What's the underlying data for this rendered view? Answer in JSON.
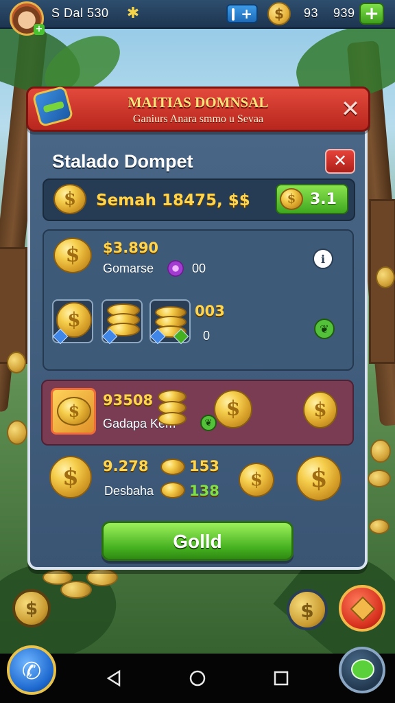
{
  "topbar": {
    "player_stat": "S Dal 530",
    "gems": "+",
    "coins_label": "93",
    "coins_value": "939",
    "add_label": "+"
  },
  "ribbon": {
    "title": "MAITIAS DOMNSAL",
    "subtitle": "Ganiurs Anara smmo u Sevaa",
    "close": "✕"
  },
  "panel": {
    "title": "Stalado Dompet",
    "close": "✕"
  },
  "balance": {
    "text": "Semah 18475, $$",
    "button_value": "3.1"
  },
  "offer": {
    "price": "$3.890",
    "name": "Gomarse",
    "count": "00",
    "bundle_price": "003",
    "bundle_count": "0"
  },
  "featured": {
    "price": "93508",
    "name": "Gadapa Kem"
  },
  "extra": {
    "amount": "9.278",
    "name": "Desbaha",
    "value_a": "153",
    "value_b": "138"
  },
  "cta": {
    "label": "Golld"
  },
  "colors": {
    "accent_green": "#45b020",
    "ribbon_red": "#c8302a",
    "gold": "#ffd44e",
    "panel_blue": "#3a5574"
  },
  "icons": {
    "phone": "phone-icon",
    "chat": "chat-icon",
    "back": "back-icon",
    "home": "home-icon",
    "recents": "recents-icon"
  }
}
